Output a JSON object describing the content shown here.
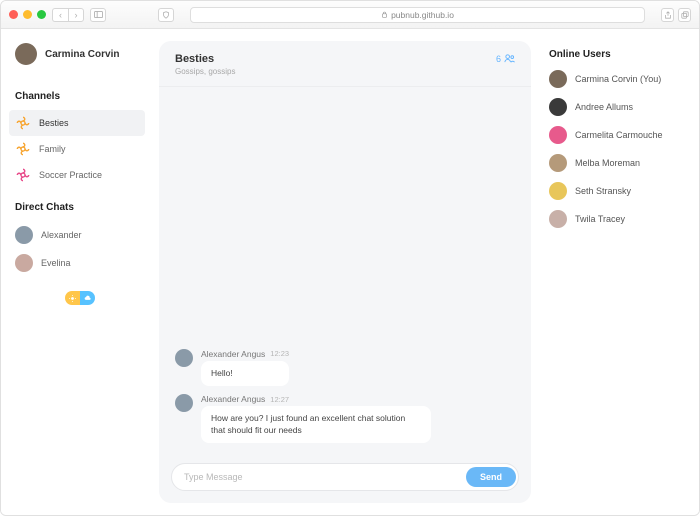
{
  "browser": {
    "url": "pubnub.github.io"
  },
  "profile": {
    "name": "Carmina Corvin",
    "avatar_color": "#7a6a5a"
  },
  "sidebar": {
    "channels_label": "Channels",
    "channels": [
      {
        "name": "Besties",
        "icon_color": "#f7a531"
      },
      {
        "name": "Family",
        "icon_color": "#f7a531"
      },
      {
        "name": "Soccer Practice",
        "icon_color": "#e84a8a"
      }
    ],
    "direct_label": "Direct Chats",
    "directs": [
      {
        "name": "Alexander",
        "avatar_color": "#8a9aa8"
      },
      {
        "name": "Evelina",
        "avatar_color": "#c9a9a0"
      }
    ]
  },
  "chat": {
    "title": "Besties",
    "subtitle": "Gossips, gossips",
    "member_count": "6",
    "messages": [
      {
        "author": "Alexander Angus",
        "time": "12:23",
        "text": "Hello!",
        "avatar_color": "#8a9aa8"
      },
      {
        "author": "Alexander Angus",
        "time": "12:27",
        "text": "How are you? I just found an excellent chat solution that should fit our needs",
        "avatar_color": "#8a9aa8"
      }
    ],
    "input_placeholder": "Type Message",
    "send_label": "Send"
  },
  "online": {
    "label": "Online Users",
    "users": [
      {
        "name": "Carmina Corvin (You)",
        "avatar_color": "#7a6a5a"
      },
      {
        "name": "Andree Allums",
        "avatar_color": "#3a3a3a"
      },
      {
        "name": "Carmelita Carmouche",
        "avatar_color": "#e75a8c"
      },
      {
        "name": "Melba Moreman",
        "avatar_color": "#b59a7a"
      },
      {
        "name": "Seth Stransky",
        "avatar_color": "#e8c65a"
      },
      {
        "name": "Twila Tracey",
        "avatar_color": "#c8b0a8"
      }
    ]
  }
}
